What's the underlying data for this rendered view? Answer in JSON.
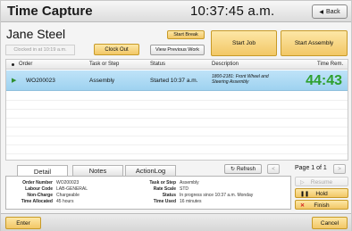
{
  "app": {
    "title": "Time Capture",
    "clock": "10:37:45 a.m.",
    "back_label": "Back"
  },
  "user": {
    "name": "Jane Steel",
    "clocked_in": "Clocked in at 10:19 a.m.",
    "clock_out_label": "Clock Out",
    "start_break_label": "Start Break",
    "view_previous_label": "View Previous Work"
  },
  "actions": {
    "start_job_label": "Start Job",
    "start_assembly_label": "Start Assembly"
  },
  "table": {
    "headers": {
      "order": "Order",
      "task": "Task or Step",
      "status": "Status",
      "description": "Description",
      "time_rem": "Time Rem."
    },
    "rows": [
      {
        "order": "WO200023",
        "task": "Assembly",
        "status": "Started 10:37 a.m.",
        "description": "1800-2181: Front Wheel and Steering Assembly",
        "time_rem": "44:43"
      }
    ]
  },
  "tabs": {
    "detail": "Detail",
    "notes": "Notes",
    "action_log": "ActionLog"
  },
  "pager": {
    "refresh_label": "Refresh",
    "page_of": "Page 1 of 1",
    "prev": "<",
    "next": ">"
  },
  "detail": {
    "labels": {
      "order_number": "Order Number",
      "labour_code": "Labour Code",
      "non_charge": "Non-Charge",
      "time_allocated": "Time Allocated",
      "task_or_step": "Task or Step",
      "rate_scale": "Rate Scale",
      "status": "Status",
      "time_used": "Time Used"
    },
    "values": {
      "order_number": "WO200023",
      "labour_code": "LAB-GENERAL",
      "non_charge": "Chargeable",
      "time_allocated": "45 hours",
      "task_or_step": "Assembly",
      "rate_scale": "STD",
      "status": "In progress since 10:37 a.m. Monday",
      "time_used": "16 minutes"
    }
  },
  "side_buttons": {
    "resume": "Resume",
    "hold": "Hold",
    "finish": "Finish"
  },
  "footer": {
    "enter_label": "Enter",
    "cancel_label": "Cancel"
  },
  "colors": {
    "accent_button": "#f2c766",
    "selected_row": "#9ed2f0",
    "time_remaining": "#2ea02e",
    "finish_icon": "#d42020"
  }
}
